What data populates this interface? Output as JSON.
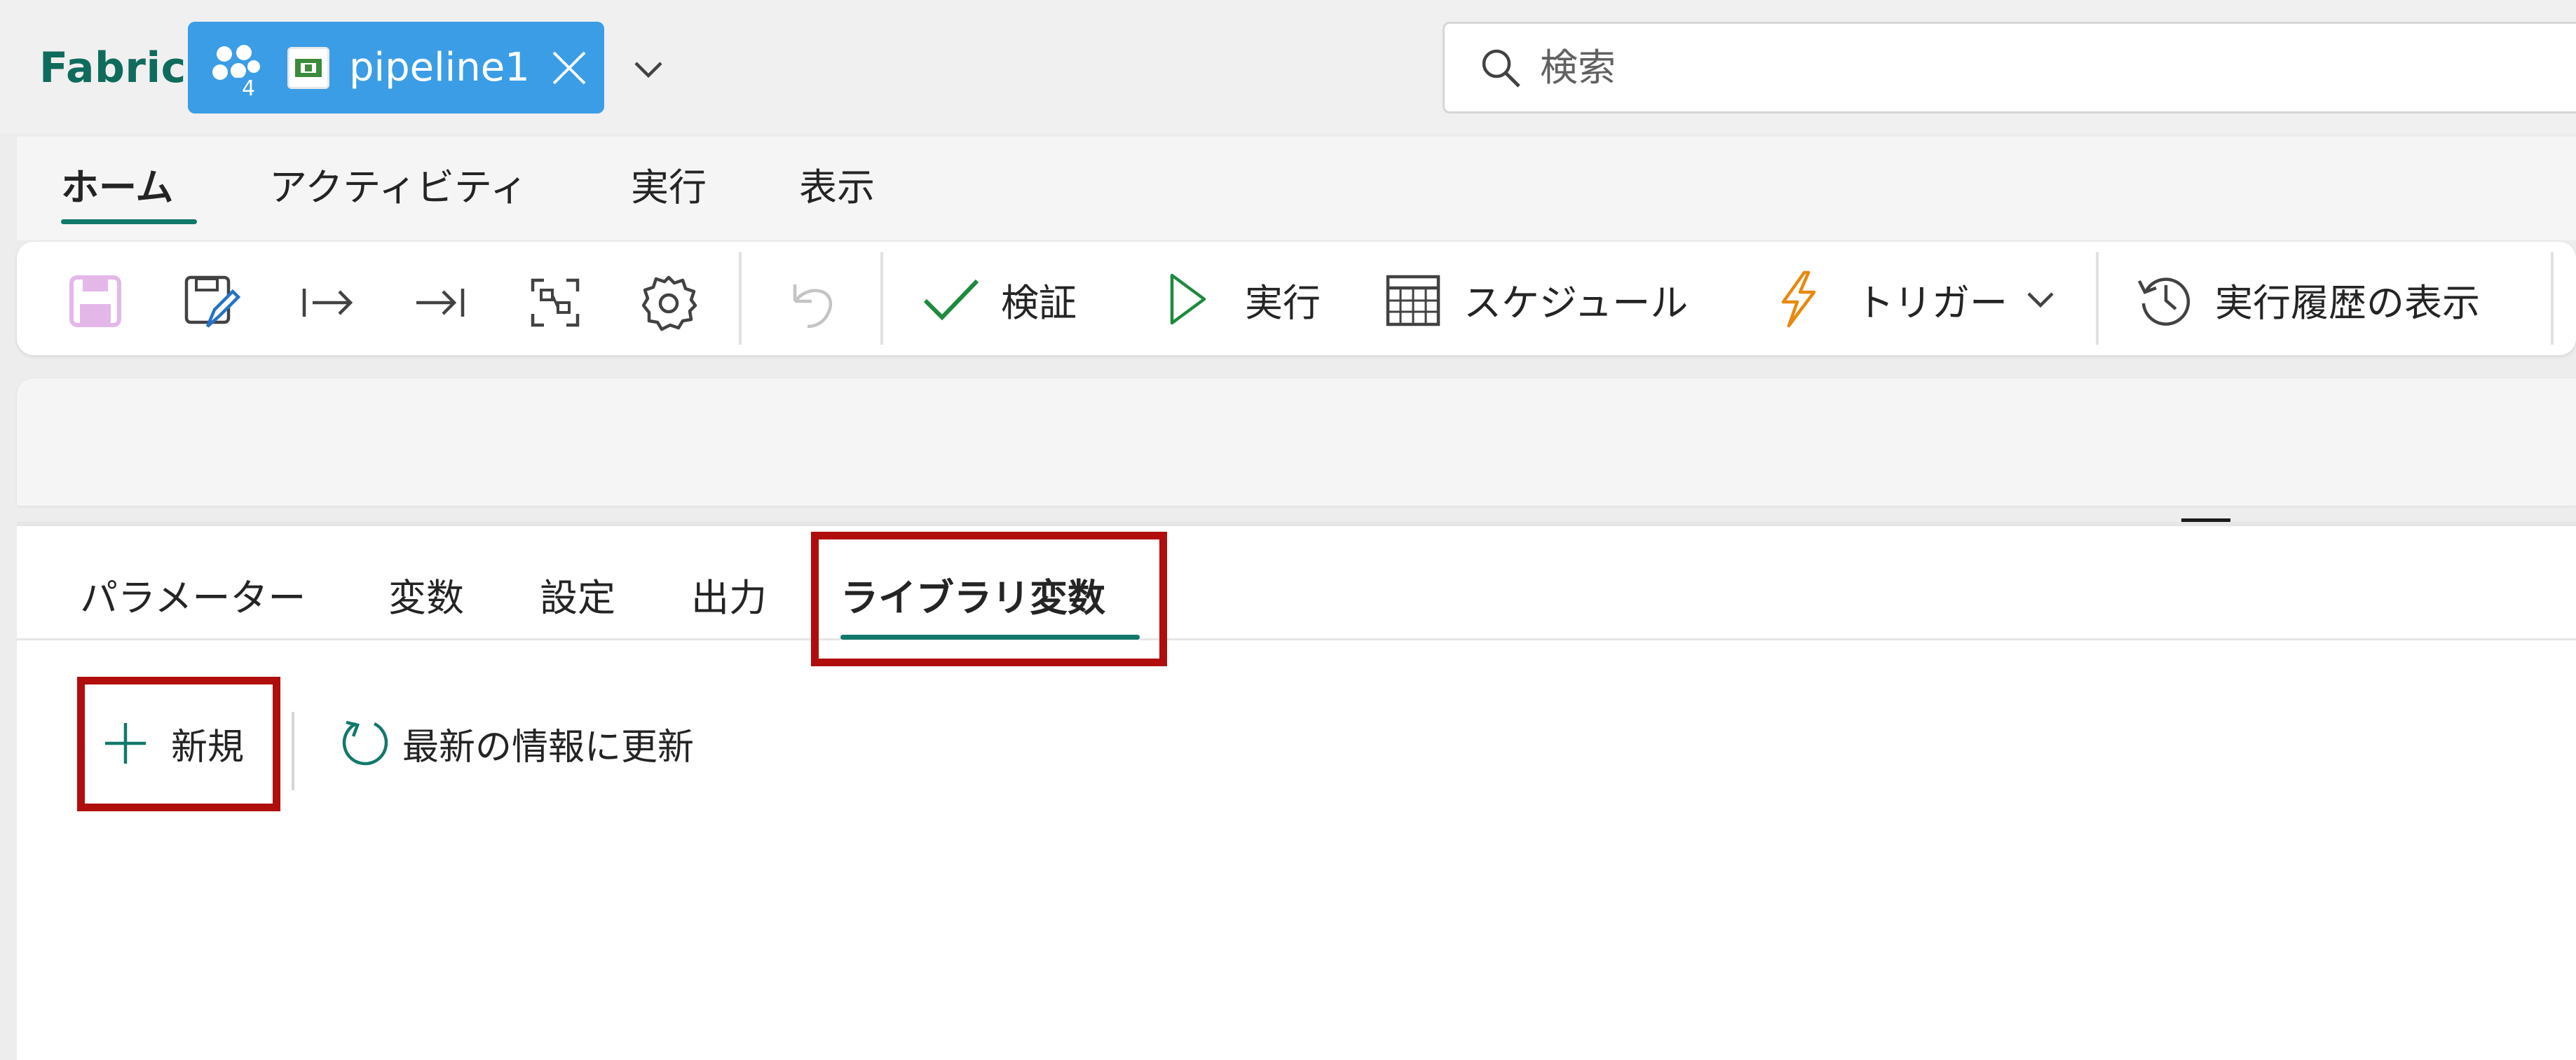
{
  "app": {
    "brand": "Fabric",
    "item_tab": {
      "workspace_badge": "4",
      "label": "pipeline1"
    },
    "search": {
      "placeholder": "検索"
    }
  },
  "ribbon": {
    "tabs": [
      {
        "label": "ホーム",
        "active": true
      },
      {
        "label": "アクティビティ",
        "active": false
      },
      {
        "label": "実行",
        "active": false
      },
      {
        "label": "表示",
        "active": false
      }
    ]
  },
  "toolbar": {
    "icons": [
      "save-icon",
      "save-as-icon",
      "move-right-icon",
      "move-to-end-icon",
      "select-shape-icon",
      "settings-icon",
      "undo-icon"
    ],
    "validate_label": "検証",
    "run_label": "実行",
    "schedule_label": "スケジュール",
    "trigger_label": "トリガー",
    "run_history_label": "実行履歴の表示"
  },
  "panel": {
    "tabs": [
      {
        "label": "パラメーター",
        "active": false
      },
      {
        "label": "変数",
        "active": false
      },
      {
        "label": "設定",
        "active": false
      },
      {
        "label": "出力",
        "active": false
      },
      {
        "label": "ライブラリ変数",
        "active": true
      }
    ],
    "actions": {
      "new_label": "新規",
      "refresh_label": "最新の情報に更新"
    }
  },
  "colors": {
    "accent": "#11786a",
    "tab_blue": "#3b9de6",
    "highlight": "#b00d0d",
    "trigger_orange": "#e8890c",
    "save_disabled": "#e3b7e8",
    "validate_green": "#1e8a3e"
  }
}
